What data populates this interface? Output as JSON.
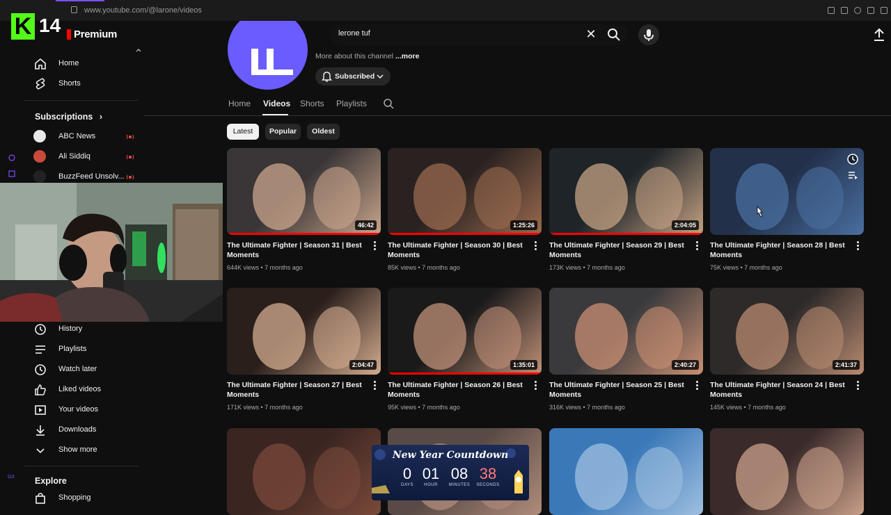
{
  "browser": {
    "url": "www.youtube.com/@larone/videos"
  },
  "overlay": {
    "logo_letter": "K",
    "logo_number": "14"
  },
  "header": {
    "premium_label": "Premium"
  },
  "search": {
    "value": "lerone tuf"
  },
  "sidebar": {
    "top_items": [
      {
        "label": "Home",
        "icon": "home-icon"
      },
      {
        "label": "Shorts",
        "icon": "shorts-icon"
      }
    ],
    "subscriptions_heading": "Subscriptions",
    "subscriptions": [
      {
        "label": "ABC News",
        "color": "#e9e9e9"
      },
      {
        "label": "Ali Siddiq",
        "color": "#c84a3a"
      },
      {
        "label": "BuzzFeed Unsolv...",
        "color": "#222222"
      }
    ],
    "you_items": [
      {
        "label": "History",
        "icon": "history-icon"
      },
      {
        "label": "Playlists",
        "icon": "playlists-icon"
      },
      {
        "label": "Watch later",
        "icon": "clock-icon"
      },
      {
        "label": "Liked videos",
        "icon": "thumbs-up-icon"
      },
      {
        "label": "Your videos",
        "icon": "play-square-icon"
      },
      {
        "label": "Downloads",
        "icon": "download-icon"
      },
      {
        "label": "Show more",
        "icon": "chevron-down-icon"
      }
    ],
    "explore_heading": "Explore",
    "explore_items": [
      {
        "label": "Shopping",
        "icon": "shopping-bag-icon"
      }
    ]
  },
  "channel": {
    "more_about": "More about this channel ",
    "more_link": "...more",
    "subscribed_label": "Subscribed",
    "tabs": [
      "Home",
      "Videos",
      "Shorts",
      "Playlists"
    ],
    "active_tab": "Videos",
    "chips": [
      "Latest",
      "Popular",
      "Oldest"
    ],
    "active_chip": "Latest"
  },
  "videos": [
    {
      "title": "The Ultimate Fighter | Season 31 | Best Moments",
      "duration": "46:42",
      "views": "644K views",
      "age": "7 months ago",
      "watched": 1.0,
      "colors": [
        "#3a3536",
        "#c9a58c"
      ]
    },
    {
      "title": "The Ultimate Fighter | Season 30 | Best Moments",
      "duration": "1:25:26",
      "views": "85K views",
      "age": "7 months ago",
      "watched": 1.0,
      "colors": [
        "#2a2220",
        "#9a6a4f"
      ]
    },
    {
      "title": "The Ultimate Fighter | Season 29 | Best Moments",
      "duration": "2:04:05",
      "views": "173K views",
      "age": "7 months ago",
      "watched": 1.0,
      "colors": [
        "#1e2428",
        "#c4a183"
      ]
    },
    {
      "title": "The Ultimate Fighter | Season 28 | Best Moments",
      "duration": "",
      "views": "75K views",
      "age": "7 months ago",
      "watched": 0.0,
      "colors": [
        "#22304a",
        "#4a6fa0"
      ]
    },
    {
      "title": "The Ultimate Fighter | Season 27 | Best Moments",
      "duration": "2:04:47",
      "views": "171K views",
      "age": "7 months ago",
      "watched": 0.0,
      "colors": [
        "#2b1f1c",
        "#d3ac8f"
      ]
    },
    {
      "title": "The Ultimate Fighter | Season 26 | Best Moments",
      "duration": "1:35:01",
      "views": "95K views",
      "age": "7 months ago",
      "watched": 1.0,
      "colors": [
        "#1b1a1a",
        "#c09078"
      ]
    },
    {
      "title": "The Ultimate Fighter | Season 25 | Best Moments",
      "duration": "2:40:27",
      "views": "316K views",
      "age": "7 months ago",
      "watched": 0.0,
      "colors": [
        "#3a3a3c",
        "#c98f73"
      ]
    },
    {
      "title": "The Ultimate Fighter | Season 24 | Best Moments",
      "duration": "2:41:37",
      "views": "145K views",
      "age": "7 months ago",
      "watched": 0.0,
      "colors": [
        "#2e2a2a",
        "#b88a70"
      ]
    },
    {
      "title": "",
      "duration": "",
      "views": "",
      "age": "",
      "watched": 0.0,
      "colors": [
        "#3a2521",
        "#7a4a3a"
      ]
    },
    {
      "title": "",
      "duration": "",
      "views": "",
      "age": "",
      "watched": 0.0,
      "colors": [
        "#5a4a45",
        "#b08c7a"
      ]
    },
    {
      "title": "",
      "duration": "",
      "views": "",
      "age": "",
      "watched": 0.0,
      "colors": [
        "#3a78b8",
        "#9fbfe0"
      ]
    },
    {
      "title": "",
      "duration": "",
      "views": "",
      "age": "",
      "watched": 0.0,
      "colors": [
        "#3a2a2a",
        "#caa08a"
      ]
    }
  ],
  "countdown": {
    "title": "New Year Countdown",
    "cells": [
      {
        "value": "0",
        "unit": "DAYS"
      },
      {
        "value": "01",
        "unit": "HOUR"
      },
      {
        "value": "08",
        "unit": "MINUTES"
      },
      {
        "value": "38",
        "unit": "SECONDS"
      }
    ],
    "accent": "#ff7a7a"
  },
  "colors": {
    "accent": "#ff0000",
    "kick_green": "#53fc18",
    "avatar_purple": "#6b5cff"
  }
}
